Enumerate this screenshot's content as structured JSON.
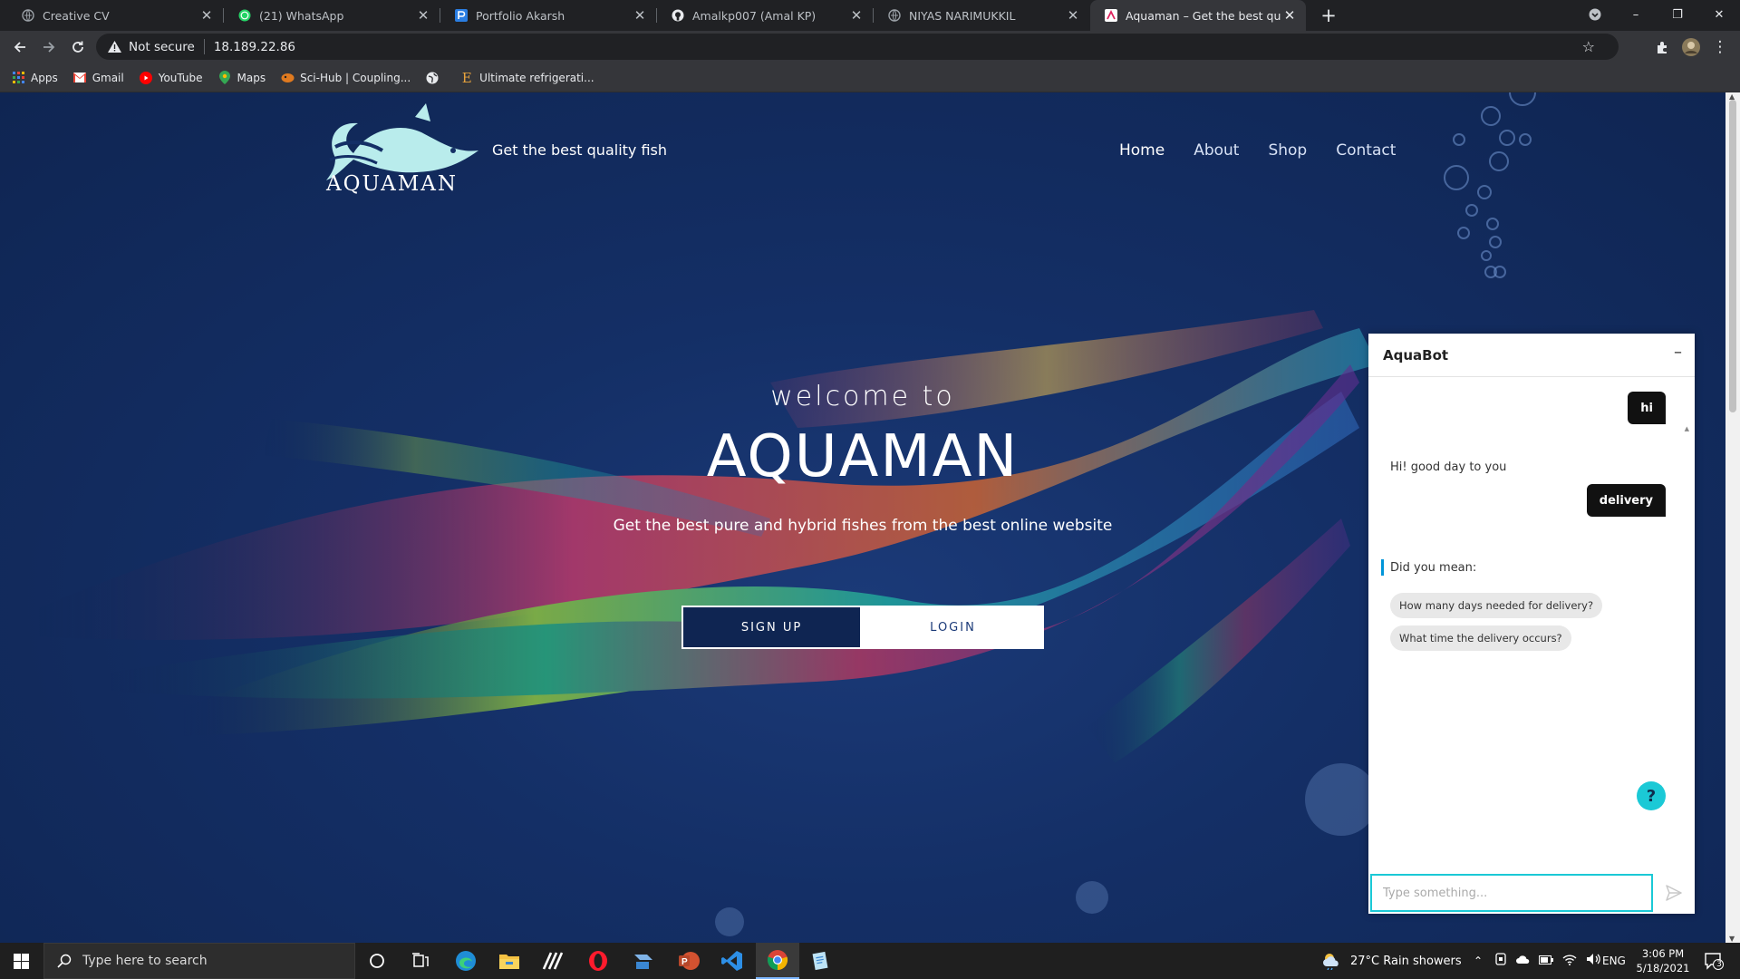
{
  "browser": {
    "tabs": [
      {
        "title": "Creative CV",
        "icon": "globe-icon"
      },
      {
        "title": "(21) WhatsApp",
        "icon": "whatsapp-icon"
      },
      {
        "title": "Portfolio Akarsh",
        "icon": "portfolio-icon"
      },
      {
        "title": "Amalkp007 (Amal KP)",
        "icon": "github-icon"
      },
      {
        "title": "NIYAS NARIMUKKIL",
        "icon": "globe-icon"
      },
      {
        "title": "Aquaman – Get the best quality fish",
        "icon": "aquaman-icon",
        "active": true
      }
    ],
    "new_tab": "+",
    "minimize": "–",
    "restore": "❐",
    "close": "✕",
    "security": "Not secure",
    "url": "18.189.22.86",
    "bookmarks": [
      "Apps",
      "Gmail",
      "YouTube",
      "Maps",
      "Sci-Hub | Coupling...",
      "Ultimate refrigerati..."
    ]
  },
  "site": {
    "logo_text": "AQUAMAN",
    "tagline": "Get the best quality fish",
    "nav": [
      "Home",
      "About",
      "Shop",
      "Contact"
    ],
    "active_nav": "Home",
    "welcome": "welcome to",
    "title": "AQUAMAN",
    "subtitle": "Get the best pure and hybrid fishes from the best online website",
    "signup": "SIGN UP",
    "login": "LOGIN"
  },
  "chatbot": {
    "title": "AquaBot",
    "minimize": "–",
    "messages": [
      {
        "from": "user",
        "text": "hi"
      },
      {
        "from": "bot",
        "text": "Hi! good day to you"
      },
      {
        "from": "user",
        "text": "delivery"
      },
      {
        "from": "bot",
        "text": "Did you mean:"
      }
    ],
    "suggestions": [
      "How many days needed for delivery?",
      "What time the delivery occurs?"
    ],
    "help": "?",
    "input_placeholder": "Type something..."
  },
  "taskbar": {
    "search_placeholder": "Type here to search",
    "weather": "27°C  Rain showers",
    "language": "ENG",
    "time": "3:06 PM",
    "date": "5/18/2021",
    "notifications": "3"
  },
  "colors": {
    "page_bg": "#142f66",
    "accent": "#1bc9d6",
    "chrome_dark": "#202124",
    "chrome_toolbar": "#35363a"
  }
}
